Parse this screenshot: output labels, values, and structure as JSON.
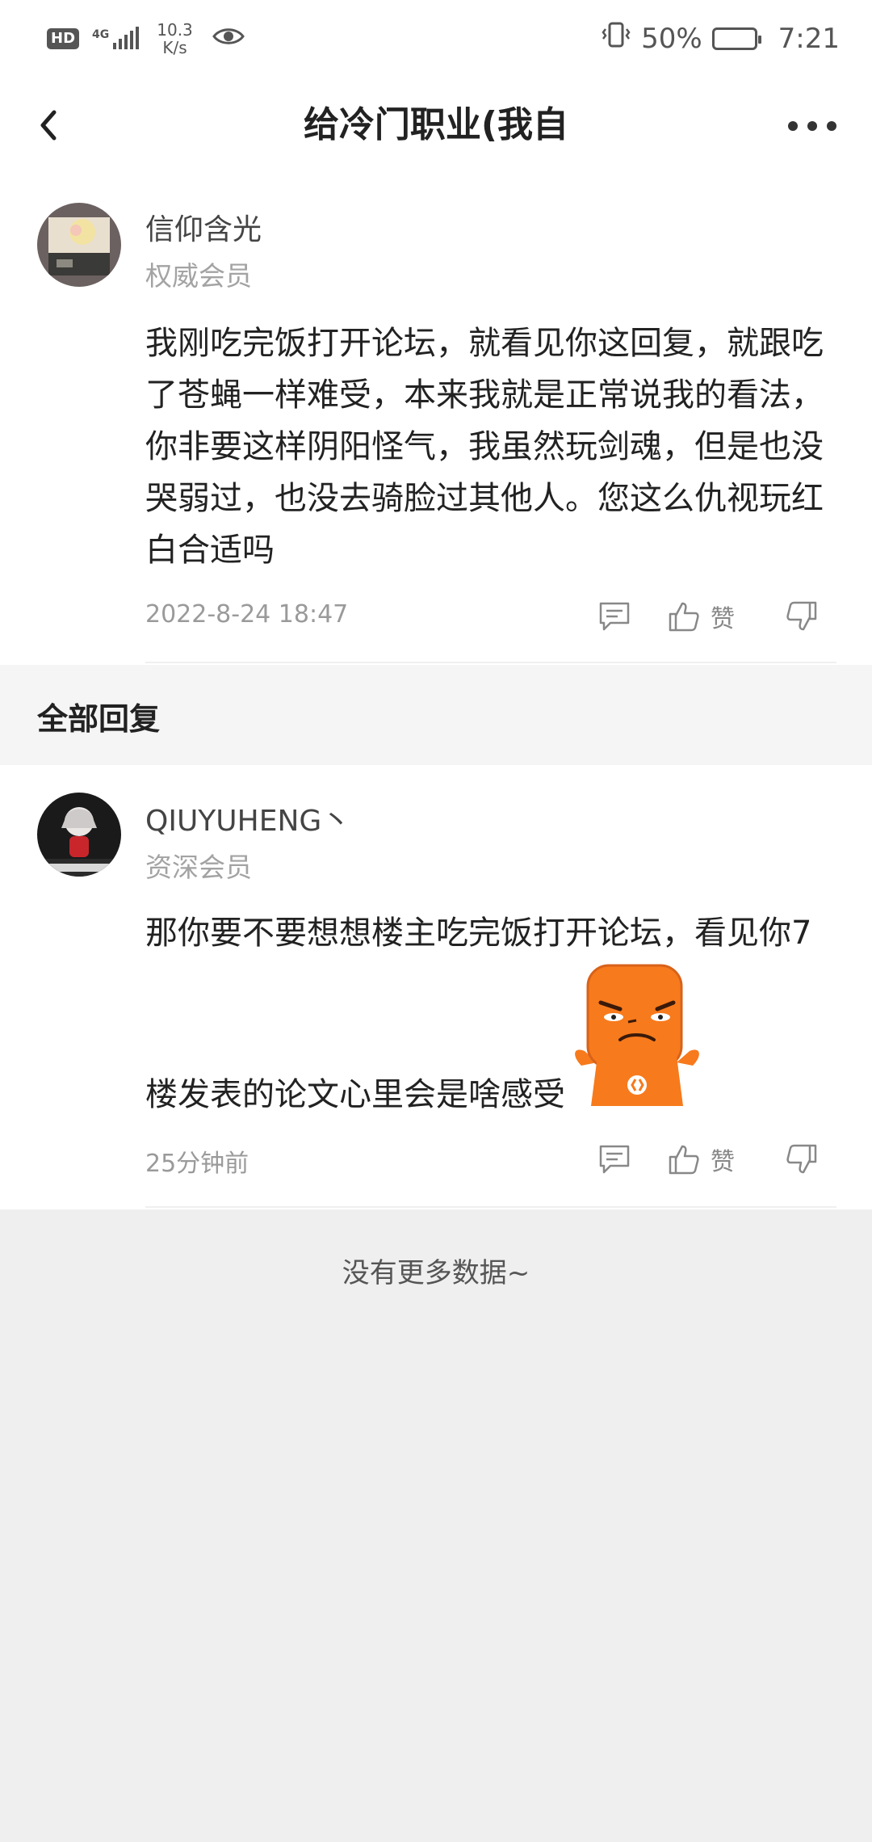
{
  "status_bar": {
    "hd": "HD",
    "network": "4G",
    "speed_value": "10.3",
    "speed_unit": "K/s",
    "battery": "50%",
    "battery_level": 0.5,
    "time": "7:21"
  },
  "nav": {
    "title": "给冷门职业(我自",
    "back_icon": "chevron-left-icon",
    "more_icon": "more-horizontal-icon"
  },
  "main_post": {
    "username": "信仰含光",
    "level": "权威会员",
    "content": [
      "我刚吃完饭打开论坛，就看见你这回复，就跟吃",
      "了苍蝇一样难受，本来我就是正常说我的看法，",
      "你非要这样阴阳怪气，我虽然玩剑魂，但是也没",
      "哭弱过，也没去骑脸过其他人。您这么仇视玩红",
      "白合适吗"
    ],
    "time": "2022-8-24 18:47",
    "like_label": "赞"
  },
  "replies_section": {
    "title": "全部回复"
  },
  "replies": [
    {
      "username": "QIUYUHENG丶",
      "level": "资深会员",
      "content_line1": "那你要不要想想楼主吃完饭打开论坛，看见你7",
      "content_line2": "楼发表的论文心里会是啥感受",
      "sticker": "angry-orange-emoji",
      "time": "25分钟前",
      "like_label": "赞"
    }
  ],
  "footer": {
    "no_more": "没有更多数据~"
  },
  "colors": {
    "background": "#efefef",
    "card": "#ffffff",
    "meta_gray": "#9a9a9a",
    "sticker_orange": "#f77a1c"
  }
}
